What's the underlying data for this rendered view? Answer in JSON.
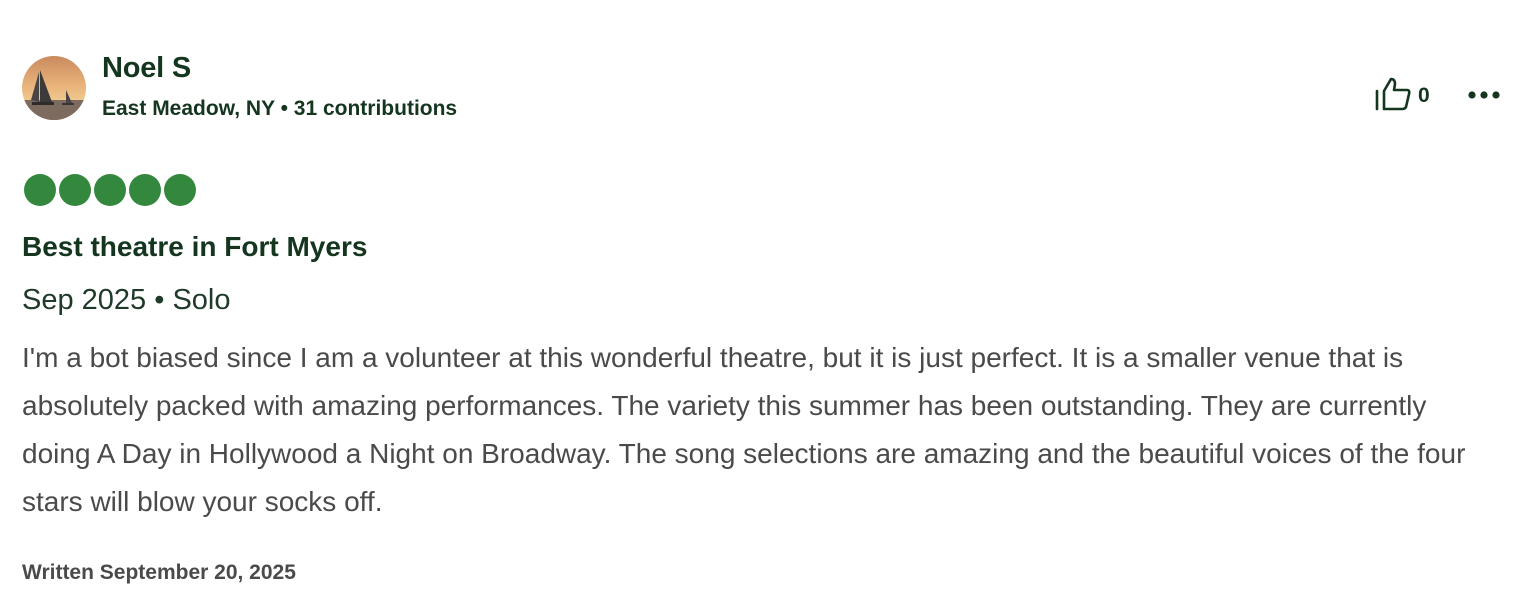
{
  "author": {
    "name": "Noel S",
    "location": "East Meadow, NY",
    "separator": "•",
    "contributions": "31 contributions"
  },
  "actions": {
    "helpful_count": "0",
    "helpful_icon": "thumbs-up-icon",
    "more_icon": "more-options-icon"
  },
  "review": {
    "rating": 5,
    "rating_max": 5,
    "title": "Best theatre in Fort Myers",
    "date": "Sep 2025",
    "trip_type": "Solo",
    "body": "I'm a bot biased since I am a volunteer at this wonderful theatre, but it is just perfect. It is a smaller venue that is absolutely packed with amazing performances. The variety this summer has been outstanding. They are currently doing A Day in Hollywood a Night on Broadway. The song selections are amazing and the beautiful voices of the four stars will blow your socks off.",
    "written": "Written September 20, 2025"
  },
  "colors": {
    "rating_bubble": "#34883e",
    "heading_text": "#14361f",
    "body_text": "#4a4a4a"
  }
}
